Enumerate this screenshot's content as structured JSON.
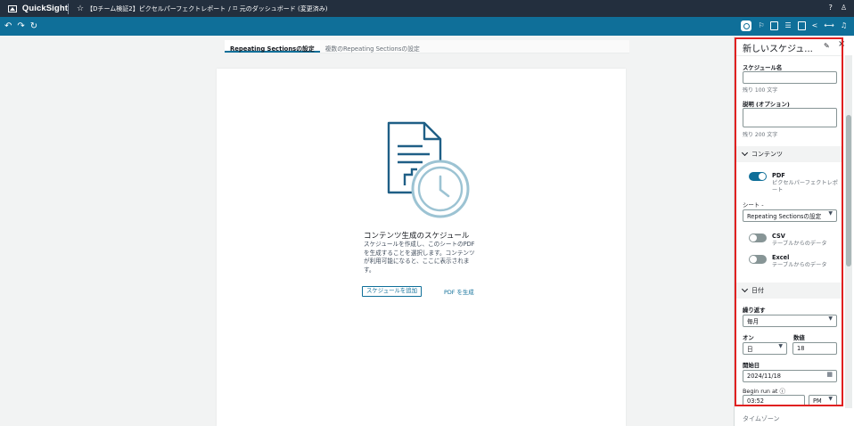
{
  "app": {
    "name": "QuickSight"
  },
  "breadcrumb": {
    "analysis": "【Dチーム検証2】ピクセルパーフェクトレポート",
    "separator": "/",
    "dashboard": "元のダッシュボード (変更済み)"
  },
  "tabs": [
    {
      "label": "Repeating Sectionsの設定",
      "active": true
    },
    {
      "label": "複数のRepeating Sectionsの設定",
      "active": false
    }
  ],
  "empty_state": {
    "title": "コンテンツ生成のスケジュール",
    "description": "スケジュールを作成し、このシートのPDF を生成することを選択します。コンテンツが利用可能になると、ここに表示されます。",
    "add_schedule_button": "スケジュールを追加",
    "generate_pdf_link": "PDF を生成"
  },
  "panel": {
    "title": "新しいスケジュ...",
    "schedule_name": {
      "label": "スケジュール名",
      "value": "",
      "hint": "残り 100 文字"
    },
    "description": {
      "label": "説明 (オプション)",
      "value": "",
      "hint": "残り 200 文字"
    },
    "content_section": {
      "label": "コンテンツ",
      "pdf": {
        "title": "PDF",
        "subtitle": "ピクセルパーフェクトレポート",
        "enabled": true
      },
      "sheet": {
        "label": "シート -",
        "value": "Repeating Sectionsの設定"
      },
      "csv": {
        "title": "CSV",
        "subtitle": "テーブルからのデータ",
        "enabled": false
      },
      "excel": {
        "title": "Excel",
        "subtitle": "テーブルからのデータ",
        "enabled": false
      }
    },
    "date_section": {
      "label": "日付",
      "repeat": {
        "label": "繰り返す",
        "value": "毎月"
      },
      "on": {
        "label": "オン",
        "value": "日"
      },
      "count": {
        "label": "数値",
        "value": "18"
      },
      "start_date": {
        "label": "開始日",
        "value": "2024/11/18"
      },
      "begin_run_at": {
        "label": "Begin run at",
        "time": "03:52",
        "ampm": "PM"
      }
    },
    "next_section_label": "タイムゾーン"
  },
  "colors": {
    "topbar": "#232f3e",
    "toolbar": "#0f6f99",
    "accent": "#0f6f99",
    "highlight_border": "#e02020"
  }
}
